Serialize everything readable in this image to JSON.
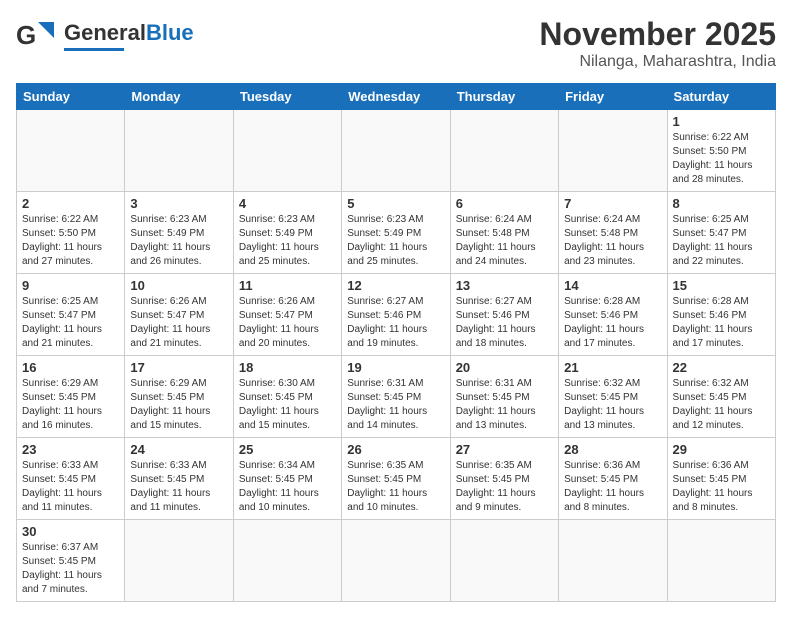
{
  "header": {
    "logo_general": "General",
    "logo_blue": "Blue",
    "title": "November 2025",
    "subtitle": "Nilanga, Maharashtra, India"
  },
  "weekdays": [
    "Sunday",
    "Monday",
    "Tuesday",
    "Wednesday",
    "Thursday",
    "Friday",
    "Saturday"
  ],
  "weeks": [
    [
      {
        "day": "",
        "info": ""
      },
      {
        "day": "",
        "info": ""
      },
      {
        "day": "",
        "info": ""
      },
      {
        "day": "",
        "info": ""
      },
      {
        "day": "",
        "info": ""
      },
      {
        "day": "",
        "info": ""
      },
      {
        "day": "1",
        "info": "Sunrise: 6:22 AM\nSunset: 5:50 PM\nDaylight: 11 hours\nand 28 minutes."
      }
    ],
    [
      {
        "day": "2",
        "info": "Sunrise: 6:22 AM\nSunset: 5:50 PM\nDaylight: 11 hours\nand 27 minutes."
      },
      {
        "day": "3",
        "info": "Sunrise: 6:23 AM\nSunset: 5:49 PM\nDaylight: 11 hours\nand 26 minutes."
      },
      {
        "day": "4",
        "info": "Sunrise: 6:23 AM\nSunset: 5:49 PM\nDaylight: 11 hours\nand 25 minutes."
      },
      {
        "day": "5",
        "info": "Sunrise: 6:23 AM\nSunset: 5:49 PM\nDaylight: 11 hours\nand 25 minutes."
      },
      {
        "day": "6",
        "info": "Sunrise: 6:24 AM\nSunset: 5:48 PM\nDaylight: 11 hours\nand 24 minutes."
      },
      {
        "day": "7",
        "info": "Sunrise: 6:24 AM\nSunset: 5:48 PM\nDaylight: 11 hours\nand 23 minutes."
      },
      {
        "day": "8",
        "info": "Sunrise: 6:25 AM\nSunset: 5:47 PM\nDaylight: 11 hours\nand 22 minutes."
      }
    ],
    [
      {
        "day": "9",
        "info": "Sunrise: 6:25 AM\nSunset: 5:47 PM\nDaylight: 11 hours\nand 21 minutes."
      },
      {
        "day": "10",
        "info": "Sunrise: 6:26 AM\nSunset: 5:47 PM\nDaylight: 11 hours\nand 21 minutes."
      },
      {
        "day": "11",
        "info": "Sunrise: 6:26 AM\nSunset: 5:47 PM\nDaylight: 11 hours\nand 20 minutes."
      },
      {
        "day": "12",
        "info": "Sunrise: 6:27 AM\nSunset: 5:46 PM\nDaylight: 11 hours\nand 19 minutes."
      },
      {
        "day": "13",
        "info": "Sunrise: 6:27 AM\nSunset: 5:46 PM\nDaylight: 11 hours\nand 18 minutes."
      },
      {
        "day": "14",
        "info": "Sunrise: 6:28 AM\nSunset: 5:46 PM\nDaylight: 11 hours\nand 17 minutes."
      },
      {
        "day": "15",
        "info": "Sunrise: 6:28 AM\nSunset: 5:46 PM\nDaylight: 11 hours\nand 17 minutes."
      }
    ],
    [
      {
        "day": "16",
        "info": "Sunrise: 6:29 AM\nSunset: 5:45 PM\nDaylight: 11 hours\nand 16 minutes."
      },
      {
        "day": "17",
        "info": "Sunrise: 6:29 AM\nSunset: 5:45 PM\nDaylight: 11 hours\nand 15 minutes."
      },
      {
        "day": "18",
        "info": "Sunrise: 6:30 AM\nSunset: 5:45 PM\nDaylight: 11 hours\nand 15 minutes."
      },
      {
        "day": "19",
        "info": "Sunrise: 6:31 AM\nSunset: 5:45 PM\nDaylight: 11 hours\nand 14 minutes."
      },
      {
        "day": "20",
        "info": "Sunrise: 6:31 AM\nSunset: 5:45 PM\nDaylight: 11 hours\nand 13 minutes."
      },
      {
        "day": "21",
        "info": "Sunrise: 6:32 AM\nSunset: 5:45 PM\nDaylight: 11 hours\nand 13 minutes."
      },
      {
        "day": "22",
        "info": "Sunrise: 6:32 AM\nSunset: 5:45 PM\nDaylight: 11 hours\nand 12 minutes."
      }
    ],
    [
      {
        "day": "23",
        "info": "Sunrise: 6:33 AM\nSunset: 5:45 PM\nDaylight: 11 hours\nand 11 minutes."
      },
      {
        "day": "24",
        "info": "Sunrise: 6:33 AM\nSunset: 5:45 PM\nDaylight: 11 hours\nand 11 minutes."
      },
      {
        "day": "25",
        "info": "Sunrise: 6:34 AM\nSunset: 5:45 PM\nDaylight: 11 hours\nand 10 minutes."
      },
      {
        "day": "26",
        "info": "Sunrise: 6:35 AM\nSunset: 5:45 PM\nDaylight: 11 hours\nand 10 minutes."
      },
      {
        "day": "27",
        "info": "Sunrise: 6:35 AM\nSunset: 5:45 PM\nDaylight: 11 hours\nand 9 minutes."
      },
      {
        "day": "28",
        "info": "Sunrise: 6:36 AM\nSunset: 5:45 PM\nDaylight: 11 hours\nand 8 minutes."
      },
      {
        "day": "29",
        "info": "Sunrise: 6:36 AM\nSunset: 5:45 PM\nDaylight: 11 hours\nand 8 minutes."
      }
    ],
    [
      {
        "day": "30",
        "info": "Sunrise: 6:37 AM\nSunset: 5:45 PM\nDaylight: 11 hours\nand 7 minutes."
      },
      {
        "day": "",
        "info": ""
      },
      {
        "day": "",
        "info": ""
      },
      {
        "day": "",
        "info": ""
      },
      {
        "day": "",
        "info": ""
      },
      {
        "day": "",
        "info": ""
      },
      {
        "day": "",
        "info": ""
      }
    ]
  ]
}
